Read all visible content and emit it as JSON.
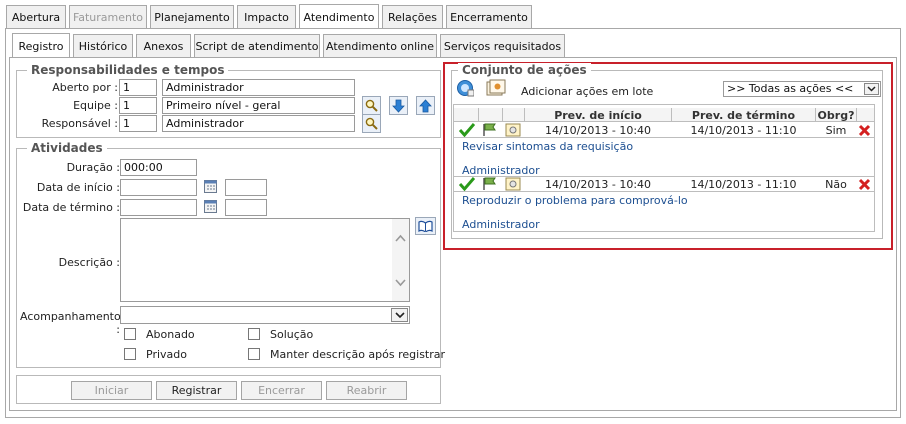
{
  "top_tabs": [
    "Abertura",
    "Faturamento",
    "Planejamento",
    "Impacto",
    "Atendimento",
    "Relações",
    "Encerramento"
  ],
  "sub_tabs": [
    "Registro",
    "Histórico",
    "Anexos",
    "Script de atendimento",
    "Atendimento online",
    "Serviços requisitados"
  ],
  "resp": {
    "title": "Responsabilidades e tempos",
    "aberto_label": "Aberto por :",
    "aberto_id": "1",
    "aberto_name": "Administrador",
    "equipe_label": "Equipe :",
    "equipe_id": "1",
    "equipe_name": "Primeiro nível - geral",
    "resp_label": "Responsável :",
    "resp_id": "1",
    "resp_name": "Administrador"
  },
  "ativ": {
    "title": "Atividades",
    "duracao_label": "Duração :",
    "duracao_value": "000:00",
    "inicio_label": "Data de início :",
    "termino_label": "Data de término :",
    "descricao_label": "Descrição :",
    "acomp_label": "Acompanhamento :",
    "abonado": "Abonado",
    "solucao": "Solução",
    "privado": "Privado",
    "manter": "Manter descrição após registrar"
  },
  "buttons": {
    "iniciar": "Iniciar",
    "registrar": "Registrar",
    "encerrar": "Encerrar",
    "reabrir": "Reabrir"
  },
  "acoes": {
    "title": "Conjunto de ações",
    "lote": "Adicionar ações em lote",
    "filter": ">> Todas as ações <<",
    "headers": [
      "Prev. de início",
      "Prev. de término",
      "Obrg?"
    ],
    "rows": [
      {
        "inicio": "14/10/2013 - 10:40",
        "termino": "14/10/2013 - 11:10",
        "obrg": "Sim",
        "desc": "Revisar sintomas da requisição",
        "user": "Administrador"
      },
      {
        "inicio": "14/10/2013 - 10:40",
        "termino": "14/10/2013 - 11:10",
        "obrg": "Não",
        "desc": "Reproduzir o problema para comprová-lo",
        "user": "Administrador"
      }
    ]
  }
}
